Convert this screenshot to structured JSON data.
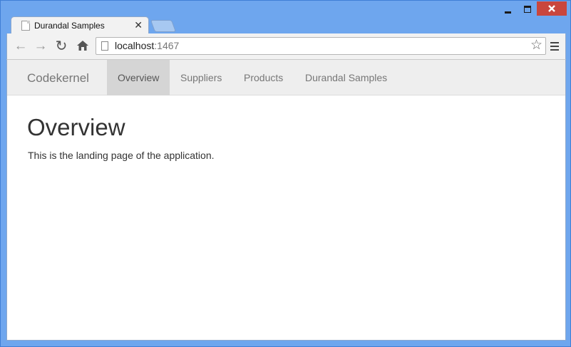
{
  "browser": {
    "tab_title": "Durandal Samples",
    "tab_close_glyph": "✕",
    "url_host": "localhost",
    "url_port": ":1467",
    "icons": [
      "minimize-icon",
      "maximize-icon",
      "close-icon",
      "back-arrow-icon",
      "forward-arrow-icon",
      "reload-icon",
      "home-icon",
      "page-icon",
      "star-icon",
      "menu-icon"
    ],
    "close_button_color": "#c9463d"
  },
  "navbar": {
    "brand": "Codekernel",
    "items": [
      {
        "label": "Overview",
        "active": true
      },
      {
        "label": "Suppliers",
        "active": false
      },
      {
        "label": "Products",
        "active": false
      },
      {
        "label": "Durandal Samples",
        "active": false
      }
    ]
  },
  "main": {
    "title": "Overview",
    "text": "This is the landing page of the application."
  }
}
